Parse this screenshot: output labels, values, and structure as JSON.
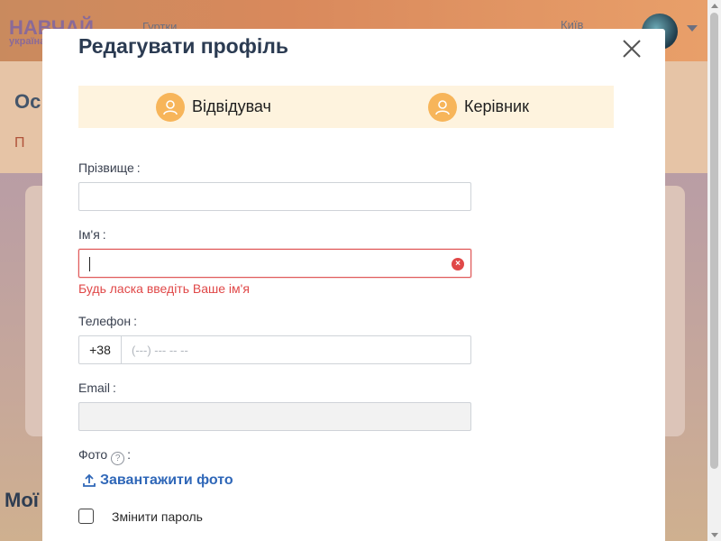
{
  "background": {
    "logo_text": "НАВЧАЙ",
    "logo_sub": "україна",
    "nav_item": "Гуртки",
    "city": "Київ",
    "section_title": "Ос",
    "section_item": "П",
    "my_heading": "Мої"
  },
  "modal": {
    "title": "Редагувати профіль",
    "close_icon": "close-icon",
    "roles": [
      {
        "label": "Відвідувач",
        "icon": "user-icon"
      },
      {
        "label": "Керівник",
        "icon": "user-icon"
      }
    ],
    "colors": {
      "role_bar_bg": "#fef3de",
      "role_icon_bg": "#f7b55a",
      "error": "#e04848",
      "link": "#2f67b8"
    },
    "fields": {
      "surname": {
        "label": "Прізвище",
        "value": ""
      },
      "name": {
        "label": "Ім'я",
        "value": "",
        "error": "Будь ласка введіть Ваше ім'я"
      },
      "phone": {
        "label": "Телефон",
        "prefix": "+38",
        "placeholder": "(---) --- -- --"
      },
      "email": {
        "label": "Email",
        "value": ""
      },
      "photo": {
        "label": "Фото",
        "help": "?"
      }
    },
    "upload_label": "Завантажити фото",
    "change_password_label": "Змінити пароль",
    "change_password_checked": false
  }
}
